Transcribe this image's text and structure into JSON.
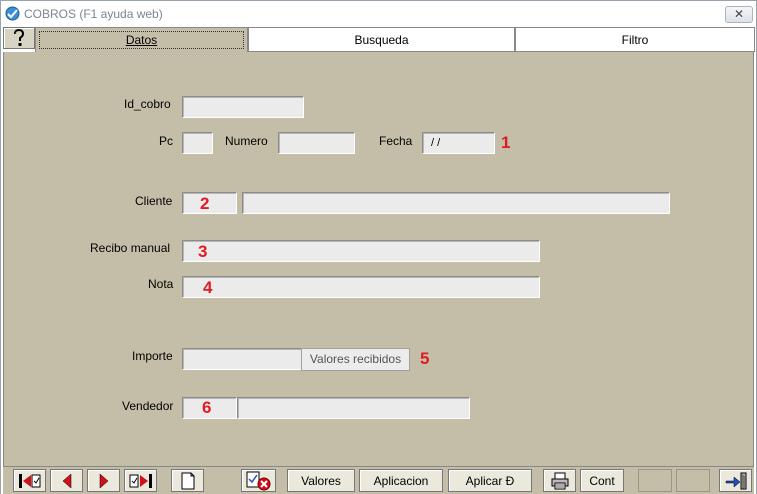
{
  "window": {
    "title": "COBROS (F1 ayuda web)",
    "close_label": "✕"
  },
  "tabs": [
    {
      "label": "Datos",
      "active": true
    },
    {
      "label": "Busqueda",
      "active": false
    },
    {
      "label": "Filtro",
      "active": false
    }
  ],
  "help_icon": "question-mark-icon",
  "form": {
    "id_cobro": {
      "label": "Id_cobro",
      "value": ""
    },
    "pc": {
      "label": "Pc",
      "value": ""
    },
    "numero": {
      "label": "Numero",
      "value": ""
    },
    "fecha": {
      "label": "Fecha",
      "value": " / /"
    },
    "cliente": {
      "label": "Cliente",
      "code": "",
      "name": ""
    },
    "recibo_manual": {
      "label": "Recibo manual",
      "value": ""
    },
    "nota": {
      "label": "Nota",
      "value": ""
    },
    "importe": {
      "label": "Importe",
      "value": "",
      "button": "Valores recibidos"
    },
    "vendedor": {
      "label": "Vendedor",
      "code": "",
      "name": ""
    }
  },
  "markers": [
    "1",
    "2",
    "3",
    "4",
    "5",
    "6"
  ],
  "toolbar": {
    "valores": "Valores",
    "aplicacion": "Aplicacion",
    "aplicar": "Aplicar Ð",
    "cont": "Cont"
  },
  "colors": {
    "panel_bg": "#c4bea8",
    "marker": "#e01b24",
    "nav_arrow": "#d0101a"
  }
}
